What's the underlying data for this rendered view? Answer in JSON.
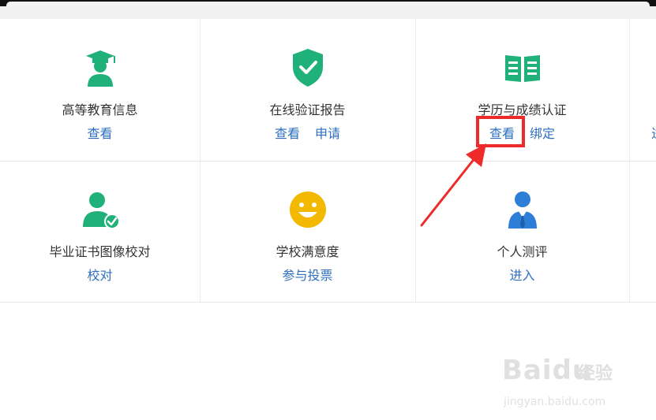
{
  "colors": {
    "accent_green": "#20b07a",
    "link_blue": "#2e6fbd",
    "face_yellow": "#f3b800",
    "person_blue": "#2d7ed7",
    "annotation_red": "#ee2a2a"
  },
  "services": [
    {
      "title": "高等教育信息",
      "icon": "graduate-icon",
      "links": [
        "查看"
      ]
    },
    {
      "title": "在线验证报告",
      "icon": "shield-check-icon",
      "links": [
        "查看",
        "申请"
      ]
    },
    {
      "title": "学历与成绩认证",
      "icon": "certificate-book-icon",
      "links": [
        "查看",
        "绑定"
      ]
    },
    {
      "title": "毕业证书图像校对",
      "icon": "user-check-icon",
      "links": [
        "校对"
      ]
    },
    {
      "title": "学校满意度",
      "icon": "smiley-icon",
      "links": [
        "参与投票"
      ]
    },
    {
      "title": "个人测评",
      "icon": "businessman-icon",
      "links": [
        "进入"
      ]
    }
  ],
  "edge_link": "进",
  "watermark": {
    "brand": "Baidu",
    "cn": "经验",
    "url": "jingyan.baidu.com"
  }
}
